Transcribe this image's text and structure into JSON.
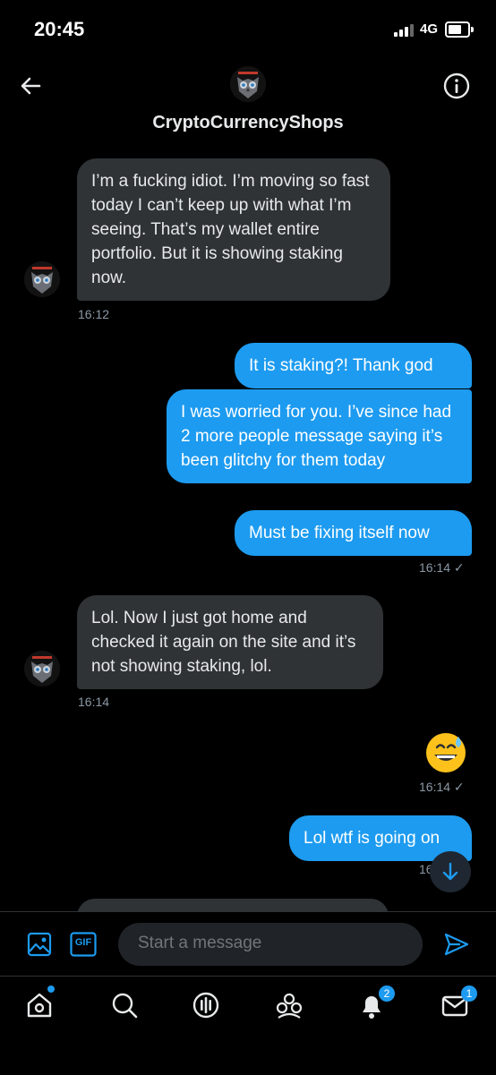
{
  "status_bar": {
    "time": "20:45",
    "network": "4G",
    "icons": [
      "signal-icon",
      "battery-icon"
    ]
  },
  "header": {
    "name": "CryptoCurrencyShops",
    "back_icon": "arrow-left-icon",
    "info_icon": "info-icon"
  },
  "messages": [
    {
      "dir": "in",
      "text": "I’m a fucking idiot. I’m moving so fast today I can’t keep up with what I’m seeing. That’s my wallet entire portfolio. But it is showing staking now.",
      "time": "16:12"
    },
    {
      "dir": "out",
      "text": "It is staking?! Thank god"
    },
    {
      "dir": "out",
      "text": "I was worried for you. I’ve since had 2 more people message saying it’s been glitchy for them today"
    },
    {
      "dir": "out",
      "text": "Must be fixing itself now",
      "time": "16:14 ✓"
    },
    {
      "dir": "in",
      "text": "Lol. Now I just got home and checked it again on the site and it’s not showing staking, lol.",
      "time": "16:14"
    },
    {
      "dir": "out",
      "emoji": "grinning-face-with-sweat",
      "time": "16:14 ✓"
    },
    {
      "dir": "out",
      "text": "Lol wtf is going on",
      "time": "16"
    }
  ],
  "compose": {
    "placeholder": "Start a message",
    "gif_label": "GIF"
  },
  "tabbar": {
    "items": [
      "home",
      "search",
      "spaces",
      "communities",
      "notifications",
      "messages"
    ],
    "notifications_badge": "2",
    "messages_badge": "1"
  },
  "colors": {
    "accent": "#1d9bf0",
    "incoming_bubble": "#2f3336",
    "background": "#000000"
  }
}
